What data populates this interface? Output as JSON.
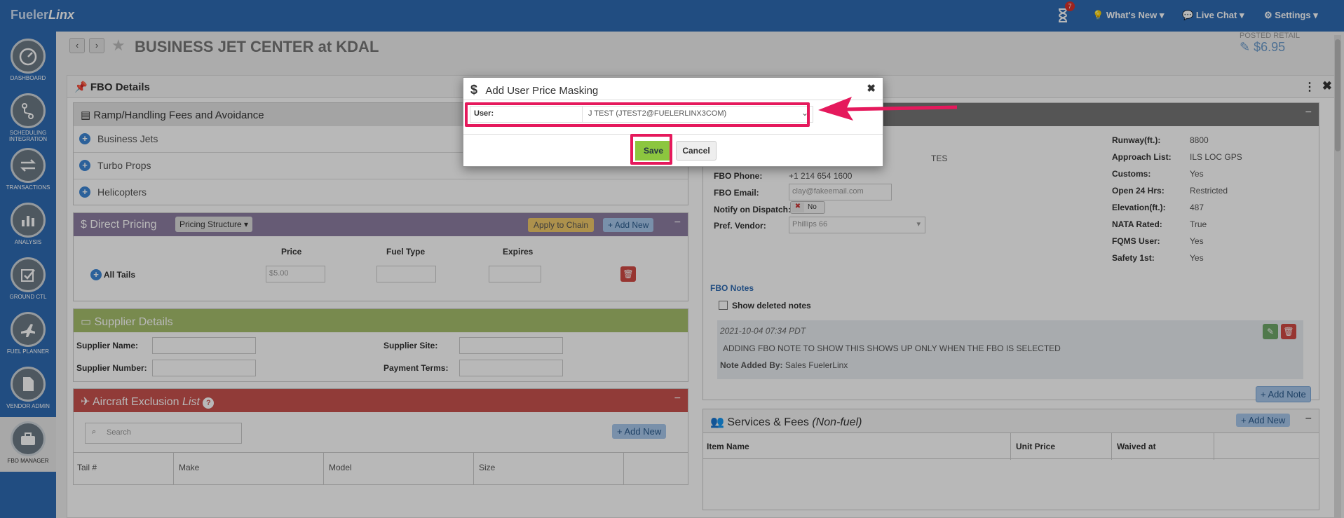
{
  "topbar": {
    "brand_main": "Fueler",
    "brand_italic": "Linx",
    "notif_count": "7",
    "whats_new": "What's New",
    "live_chat": "Live Chat",
    "settings": "Settings"
  },
  "sidebar": {
    "items": [
      {
        "label": "DASHBOARD",
        "icon": "gauge-icon"
      },
      {
        "label": "SCHEDULING INTEGRATION",
        "icon": "route-icon"
      },
      {
        "label": "TRANSACTIONS",
        "icon": "exchange-icon"
      },
      {
        "label": "ANALYSIS",
        "icon": "bar-chart-icon"
      },
      {
        "label": "GROUND CTL",
        "icon": "checkbox-icon"
      },
      {
        "label": "FUEL PLANNER",
        "icon": "plane-icon"
      },
      {
        "label": "VENDOR ADMIN",
        "icon": "document-icon"
      },
      {
        "label": "FBO MANAGER",
        "icon": "briefcase-icon"
      }
    ]
  },
  "page": {
    "title": "BUSINESS JET CENTER at KDAL",
    "posted_retail_label": "POSTED RETAIL",
    "posted_retail_value": "$6.95"
  },
  "fbo_details": {
    "title": "FBO Details",
    "ramp": {
      "title": "Ramp/Handling Fees and Avoidance",
      "rows": [
        "Business Jets",
        "Turbo Props",
        "Helicopters"
      ]
    },
    "direct_pricing": {
      "title": "Direct Pricing",
      "structure_button": "Pricing Structure",
      "apply_button": "Apply to Chain",
      "add_button": "Add New",
      "col_price": "Price",
      "col_fuel_type": "Fuel Type",
      "col_expires": "Expires",
      "row_label": "All Tails",
      "price_value": "$5.00"
    },
    "supplier": {
      "title": "Supplier Details",
      "name_label": "Supplier Name:",
      "number_label": "Supplier Number:",
      "site_label": "Supplier Site:",
      "terms_label": "Payment Terms:"
    },
    "exclusion": {
      "title": "Aircraft Exclusion",
      "title_italic": "List",
      "search_placeholder": "Search",
      "add_button": "Add New",
      "columns": [
        "Tail #",
        "Make",
        "Model",
        "Size"
      ]
    }
  },
  "fbo_info": {
    "address_tail": "TES",
    "phone_label": "FBO Phone:",
    "phone_value": "+1 214 654 1600",
    "email_label": "FBO Email:",
    "email_value": "clay@fakeemail.com",
    "notify_label": "Notify on Dispatch:",
    "notify_toggle": "No",
    "vendor_label": "Pref. Vendor:",
    "vendor_value": "Phillips 66",
    "stats": [
      {
        "label": "Runway(ft.):",
        "value": "8800"
      },
      {
        "label": "Approach List:",
        "value": "ILS LOC GPS"
      },
      {
        "label": "Customs:",
        "value": "Yes"
      },
      {
        "label": "Open 24 Hrs:",
        "value": "Restricted"
      },
      {
        "label": "Elevation(ft.):",
        "value": "487"
      },
      {
        "label": "NATA Rated:",
        "value": "True"
      },
      {
        "label": "FQMS User:",
        "value": "Yes"
      },
      {
        "label": "Safety 1st:",
        "value": "Yes"
      }
    ],
    "notes_title": "FBO Notes",
    "show_deleted": "Show deleted notes",
    "note_date": "2021-10-04 07:34 PDT",
    "note_text": "ADDING FBO NOTE TO SHOW THIS SHOWS UP ONLY WHEN THE FBO IS SELECTED",
    "note_by_label": "Note Added By:",
    "note_by_value": "Sales FuelerLinx",
    "add_note": "Add Note"
  },
  "services": {
    "title": "Services & Fees",
    "title_italic": "(Non-fuel)",
    "add_button": "Add New",
    "columns": [
      "Item Name",
      "Unit Price",
      "Waived at"
    ]
  },
  "modal": {
    "title": "Add User Price Masking",
    "user_label": "User:",
    "user_value": "J TEST (JTEST2@FUELERLINX3COM)",
    "save": "Save",
    "cancel": "Cancel"
  },
  "colors": {
    "topbar": "#2f6bb3",
    "direct_pricing_header": "#8e7fa3",
    "supplier_header": "#a7bf6c",
    "exclusion_header": "#c9524e",
    "highlight": "#e5195c",
    "save_button": "#8cc63f"
  }
}
